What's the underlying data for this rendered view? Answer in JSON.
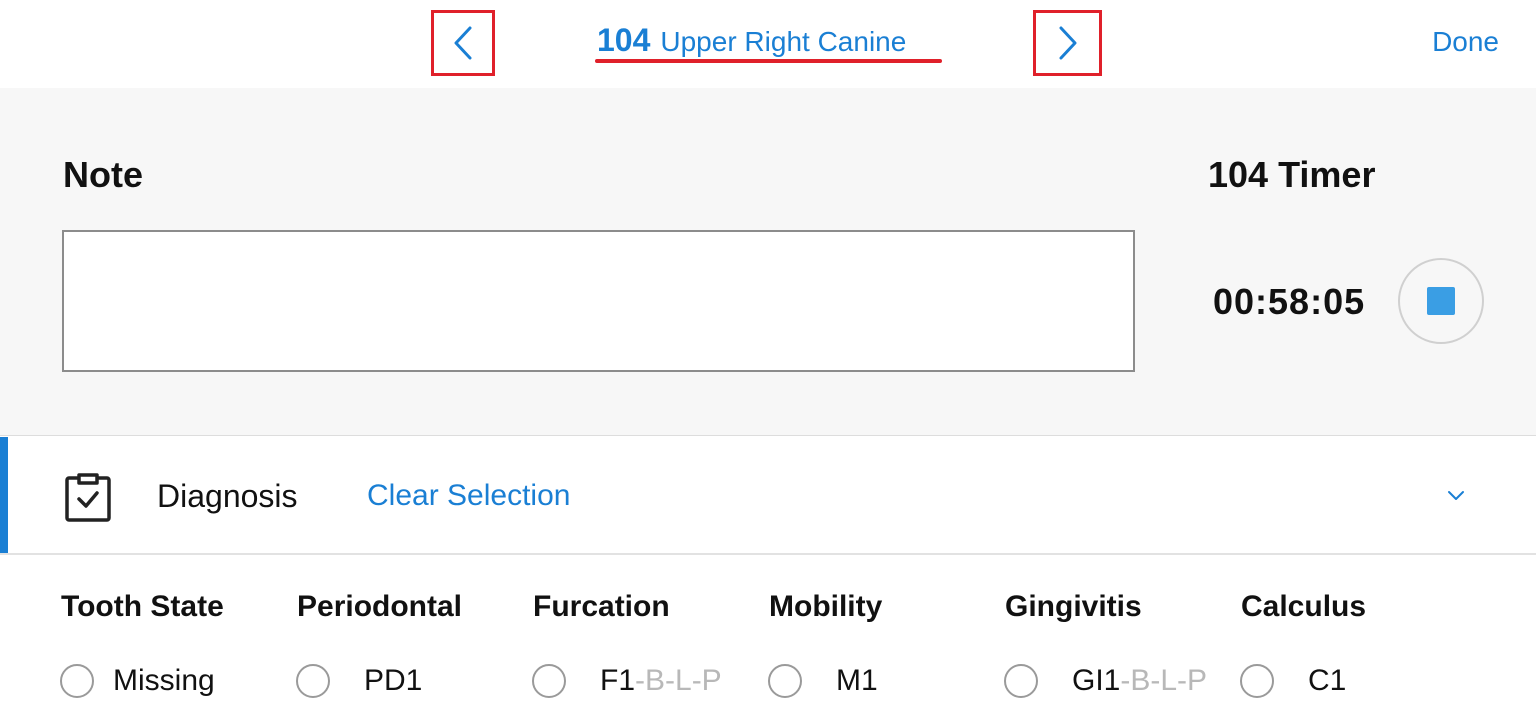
{
  "header": {
    "prev_icon": "chevron-left-icon",
    "next_icon": "chevron-right-icon",
    "tooth_number": "104",
    "tooth_name": "Upper Right Canine",
    "done_label": "Done"
  },
  "note": {
    "label": "Note",
    "value": ""
  },
  "timer": {
    "label": "104 Timer",
    "value": "00:58:05",
    "stop_icon": "stop-icon"
  },
  "diagnosis": {
    "icon": "clipboard-check-icon",
    "label": "Diagnosis",
    "clear_label": "Clear Selection",
    "toggle_icon": "chevron-down-icon"
  },
  "categories": [
    {
      "title": "Tooth State",
      "option": "Missing",
      "suffix": ""
    },
    {
      "title": "Periodontal",
      "option": "PD1",
      "suffix": ""
    },
    {
      "title": "Furcation",
      "option": "F1",
      "suffix": "-B-L-P"
    },
    {
      "title": "Mobility",
      "option": "M1",
      "suffix": ""
    },
    {
      "title": "Gingivitis",
      "option": "GI1",
      "suffix": "-B-L-P"
    },
    {
      "title": "Calculus",
      "option": "C1",
      "suffix": ""
    }
  ],
  "colors": {
    "accent": "#1a7fd4",
    "highlight": "#e0202a",
    "stop": "#3a9ee4"
  }
}
